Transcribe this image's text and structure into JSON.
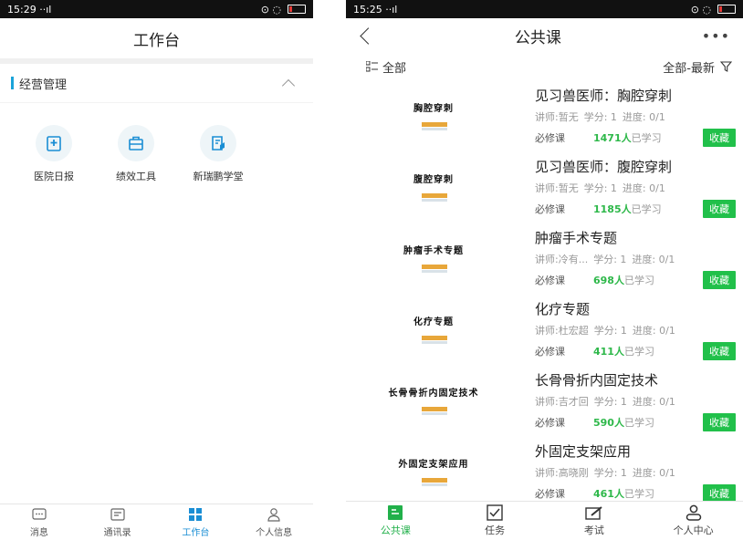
{
  "left": {
    "status": {
      "time": "15:29",
      "signal": "··ıl",
      "icons": "⊙ ◌"
    },
    "title": "工作台",
    "section": {
      "title": "经营管理"
    },
    "apps": [
      {
        "label": "医院日报",
        "icon": "hospital-report-icon"
      },
      {
        "label": "绩效工具",
        "icon": "toolbox-icon"
      },
      {
        "label": "新瑞鹏学堂",
        "icon": "school-icon"
      }
    ],
    "tabs": [
      {
        "label": "消息",
        "icon": "message-icon",
        "active": false
      },
      {
        "label": "通讯录",
        "icon": "contacts-icon",
        "active": false
      },
      {
        "label": "工作台",
        "icon": "workbench-icon",
        "active": true
      },
      {
        "label": "个人信息",
        "icon": "person-icon",
        "active": false
      }
    ],
    "colors": {
      "accent": "#1a8ed4",
      "section_bar": "#1aa3d9"
    }
  },
  "right": {
    "status": {
      "time": "15:25",
      "signal": "··ıl",
      "icons": "⊙ ◌"
    },
    "title": "公共课",
    "more": "•••",
    "filter": {
      "all": "全部",
      "sort": "全部-最新"
    },
    "courses": [
      {
        "title": "见习兽医师：胸腔穿刺",
        "thumb_title": "胸腔穿刺",
        "lecturer": "讲师:暂无",
        "credit": "学分: 1",
        "progress": "进度: 0/1",
        "type": "必修课",
        "count": "1471人",
        "learned": "已学习",
        "fav": "收藏"
      },
      {
        "title": "见习兽医师：腹腔穿刺",
        "thumb_title": "腹腔穿刺",
        "lecturer": "讲师:暂无",
        "credit": "学分: 1",
        "progress": "进度: 0/1",
        "type": "必修课",
        "count": "1185人",
        "learned": "已学习",
        "fav": "收藏"
      },
      {
        "title": "肿瘤手术专题",
        "thumb_title": "肿瘤手术专题",
        "lecturer": "讲师:冷有...",
        "credit": "学分: 1",
        "progress": "进度: 0/1",
        "type": "必修课",
        "count": "698人",
        "learned": "已学习",
        "fav": "收藏"
      },
      {
        "title": "化疗专题",
        "thumb_title": "化疗专题",
        "lecturer": "讲师:杜宏超",
        "credit": "学分: 1",
        "progress": "进度: 0/1",
        "type": "必修课",
        "count": "411人",
        "learned": "已学习",
        "fav": "收藏"
      },
      {
        "title": "长骨骨折内固定技术",
        "thumb_title": "长骨骨折内固定技术",
        "lecturer": "讲师:吉才回",
        "credit": "学分: 1",
        "progress": "进度: 0/1",
        "type": "必修课",
        "count": "590人",
        "learned": "已学习",
        "fav": "收藏"
      },
      {
        "title": "外固定支架应用",
        "thumb_title": "外固定支架应用",
        "lecturer": "讲师:高晓刚",
        "credit": "学分: 1",
        "progress": "进度: 0/1",
        "type": "必修课",
        "count": "461人",
        "learned": "已学习",
        "fav": "收藏"
      }
    ],
    "tabs": [
      {
        "label": "公共课",
        "icon": "public-course-icon",
        "active": true
      },
      {
        "label": "任务",
        "icon": "task-icon",
        "active": false
      },
      {
        "label": "考试",
        "icon": "exam-icon",
        "active": false
      },
      {
        "label": "个人中心",
        "icon": "person-icon",
        "active": false
      }
    ],
    "colors": {
      "accent": "#21b04a",
      "fav_bg": "#21c04a",
      "count": "#2eb84a"
    }
  }
}
